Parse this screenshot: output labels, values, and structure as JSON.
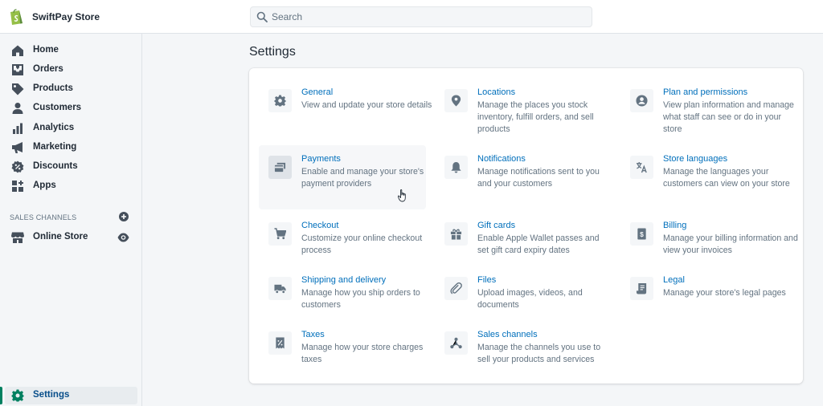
{
  "app": {
    "store_name": "SwiftPay Store"
  },
  "search": {
    "placeholder": "Search"
  },
  "sidebar": {
    "items": [
      {
        "label": "Home",
        "icon": "home-icon"
      },
      {
        "label": "Orders",
        "icon": "orders-icon"
      },
      {
        "label": "Products",
        "icon": "tag-icon"
      },
      {
        "label": "Customers",
        "icon": "person-icon"
      },
      {
        "label": "Analytics",
        "icon": "bar-chart-icon"
      },
      {
        "label": "Marketing",
        "icon": "megaphone-icon"
      },
      {
        "label": "Discounts",
        "icon": "discount-icon"
      },
      {
        "label": "Apps",
        "icon": "apps-icon"
      }
    ],
    "sales_channels_heading": "SALES CHANNELS",
    "online_store": "Online Store",
    "settings": "Settings"
  },
  "main": {
    "title": "Settings",
    "settings": [
      {
        "title": "General",
        "desc": "View and update your store details",
        "icon": "gear-icon"
      },
      {
        "title": "Locations",
        "desc": "Manage the places you stock inventory, fulfill orders, and sell products",
        "icon": "location-pin-icon"
      },
      {
        "title": "Plan and permissions",
        "desc": "View plan information and manage what staff can see or do in your store",
        "icon": "account-icon"
      },
      {
        "title": "Payments",
        "desc": "Enable and manage your store's payment providers",
        "icon": "payment-card-icon"
      },
      {
        "title": "Notifications",
        "desc": "Manage notifications sent to you and your customers",
        "icon": "bell-icon"
      },
      {
        "title": "Store languages",
        "desc": "Manage the languages your customers can view on your store",
        "icon": "translate-icon"
      },
      {
        "title": "Checkout",
        "desc": "Customize your online checkout process",
        "icon": "cart-icon"
      },
      {
        "title": "Gift cards",
        "desc": "Enable Apple Wallet passes and set gift card expiry dates",
        "icon": "gift-icon"
      },
      {
        "title": "Billing",
        "desc": "Manage your billing information and view your invoices",
        "icon": "invoice-icon"
      },
      {
        "title": "Shipping and delivery",
        "desc": "Manage how you ship orders to customers",
        "icon": "truck-icon"
      },
      {
        "title": "Files",
        "desc": "Upload images, videos, and documents",
        "icon": "paperclip-icon"
      },
      {
        "title": "Legal",
        "desc": "Manage your store's legal pages",
        "icon": "legal-document-icon"
      },
      {
        "title": "Taxes",
        "desc": "Manage how your store charges taxes",
        "icon": "tax-icon"
      },
      {
        "title": "Sales channels",
        "desc": "Manage the channels you use to sell your products and services",
        "icon": "channels-icon"
      }
    ]
  },
  "colors": {
    "link": "#006fbb",
    "brand": "#95bf47",
    "active": "#008060"
  }
}
